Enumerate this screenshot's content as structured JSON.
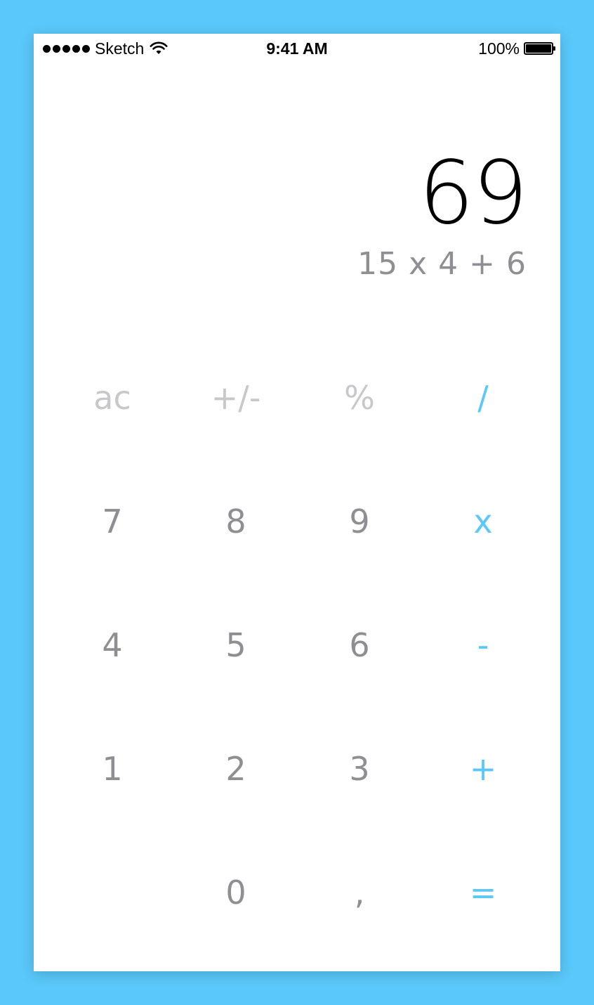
{
  "status_bar": {
    "carrier": "Sketch",
    "time": "9:41 AM",
    "battery": "100%"
  },
  "display": {
    "result": "69",
    "expression": "15 x 4 + 6"
  },
  "keypad": {
    "row1": [
      "ac",
      "+/-",
      "%",
      "/"
    ],
    "row2": [
      "7",
      "8",
      "9",
      "x"
    ],
    "row3": [
      "4",
      "5",
      "6",
      "-"
    ],
    "row4": [
      "1",
      "2",
      "3",
      "+"
    ],
    "row5": [
      "",
      "0",
      ",",
      "="
    ]
  },
  "colors": {
    "background": "#5AC8FA",
    "operator": "#5AC8FA",
    "digit": "#8e8e93",
    "function": "#c7c7cc",
    "result": "#000000"
  },
  "icons": {
    "signal": "signal-dots-icon",
    "wifi": "wifi-icon",
    "battery": "battery-icon"
  }
}
